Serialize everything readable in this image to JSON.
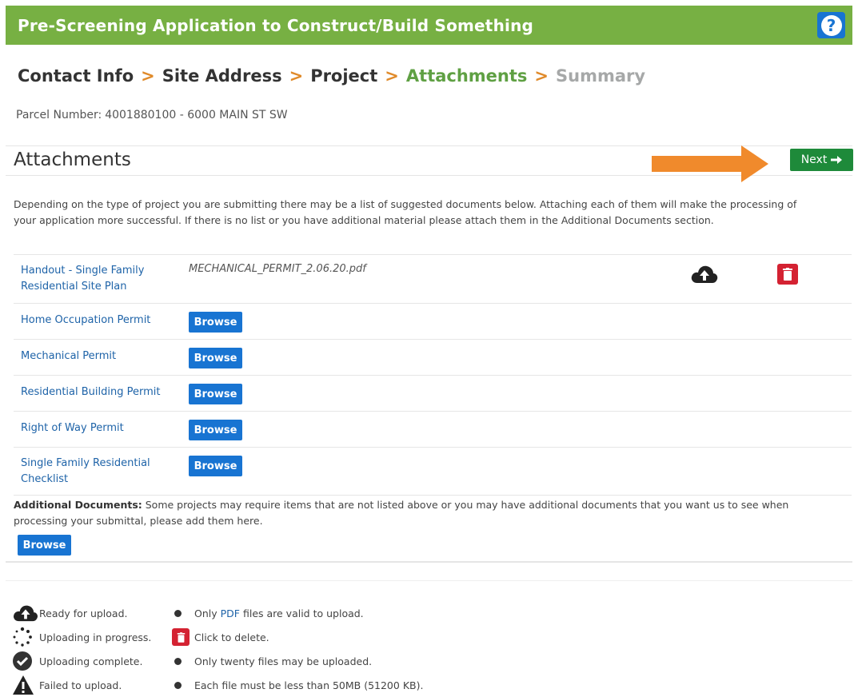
{
  "header": {
    "title": "Pre-Screening Application to Construct/Build Something",
    "help_label": "?"
  },
  "breadcrumb": {
    "items": [
      "Contact Info",
      "Site Address",
      "Project",
      "Attachments",
      "Summary"
    ],
    "separator": ">"
  },
  "parcel": {
    "label": "Parcel Number:",
    "value": "4001880100 - 6000 MAIN ST SW"
  },
  "section": {
    "title": "Attachments",
    "next_label": "Next"
  },
  "description": "Depending on the type of project you are submitting there may be a list of suggested documents below. Attaching each of them will make the processing of your application more successful. If there is no list or you have additional material please attach them in the Additional Documents section.",
  "documents": [
    {
      "label": "Handout - Single Family Residential Site Plan",
      "file": "MECHANICAL_PERMIT_2.06.20.pdf"
    },
    {
      "label": "Home Occupation Permit",
      "browse": "Browse"
    },
    {
      "label": "Mechanical Permit",
      "browse": "Browse"
    },
    {
      "label": "Residential Building Permit",
      "browse": "Browse"
    },
    {
      "label": "Right of Way Permit",
      "browse": "Browse"
    },
    {
      "label": "Single Family Residential Checklist",
      "browse": "Browse"
    }
  ],
  "additional": {
    "label": "Additional Documents:",
    "text": "Some projects may require items that are not listed above or you may have additional documents that you want us to see when processing your submittal, please add them here.",
    "browse": "Browse"
  },
  "legend": {
    "ready": "Ready for upload.",
    "progress": "Uploading in progress.",
    "complete": "Uploading complete.",
    "failed": "Failed to upload.",
    "rule1_pre": "Only",
    "rule1_pdf": "PDF",
    "rule1_post": "files are valid to upload.",
    "delete": "Click to delete.",
    "rule2": "Only twenty files may be uploaded.",
    "rule3": "Each file must be less than 50MB (51200 KB)."
  },
  "colors": {
    "header_green": "#77b043",
    "active_step": "#5fa043",
    "next_button": "#1e8a3a",
    "browse_blue": "#1874d2",
    "delete_red": "#d42232",
    "arrow_orange": "#f08a2c"
  }
}
